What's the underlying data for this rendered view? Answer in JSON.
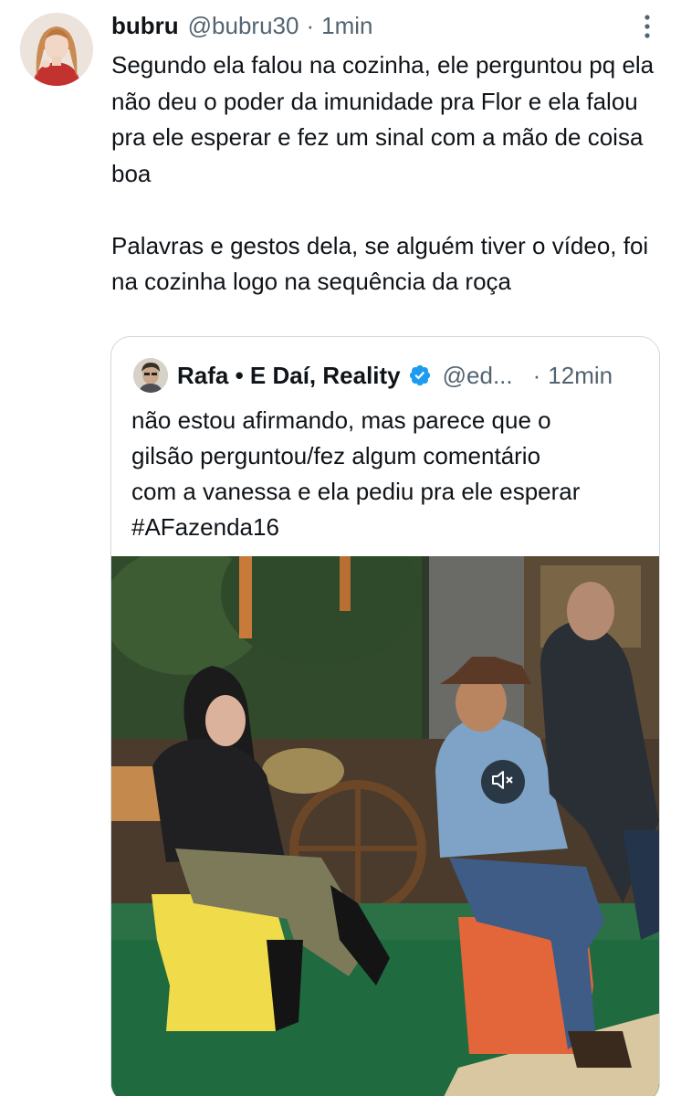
{
  "tweet": {
    "display_name": "bubru",
    "handle": "@bubru30",
    "separator": "·",
    "time": "1min",
    "more_icon": "more-vertical-icon",
    "paragraphs": [
      "Segundo ela falou na cozinha, ele perguntou pq ela não deu o poder da imunidade pra Flor e ela falou pra ele esperar e fez um sinal com a mão de coisa boa",
      "Palavras e gestos dela, se alguém tiver o vídeo, foi na cozinha logo na sequência da roça"
    ]
  },
  "quoted": {
    "display_name": "Rafa • E Daí, Reality",
    "verified_icon": "verified-badge-icon",
    "verified_color": "#1d9bf0",
    "handle": "@ed...",
    "separator": "·",
    "time": "12min",
    "lines": [
      "não estou afirmando, mas parece que o",
      "gilsão perguntou/fez algum comentário",
      "com a vanessa e ela pediu pra ele esperar",
      "#AFazenda16"
    ],
    "media": {
      "type": "video",
      "mute_icon": "volume-muted-icon"
    }
  },
  "colors": {
    "text": "#0f1419",
    "secondary": "#536471",
    "border": "#cfd9de"
  }
}
